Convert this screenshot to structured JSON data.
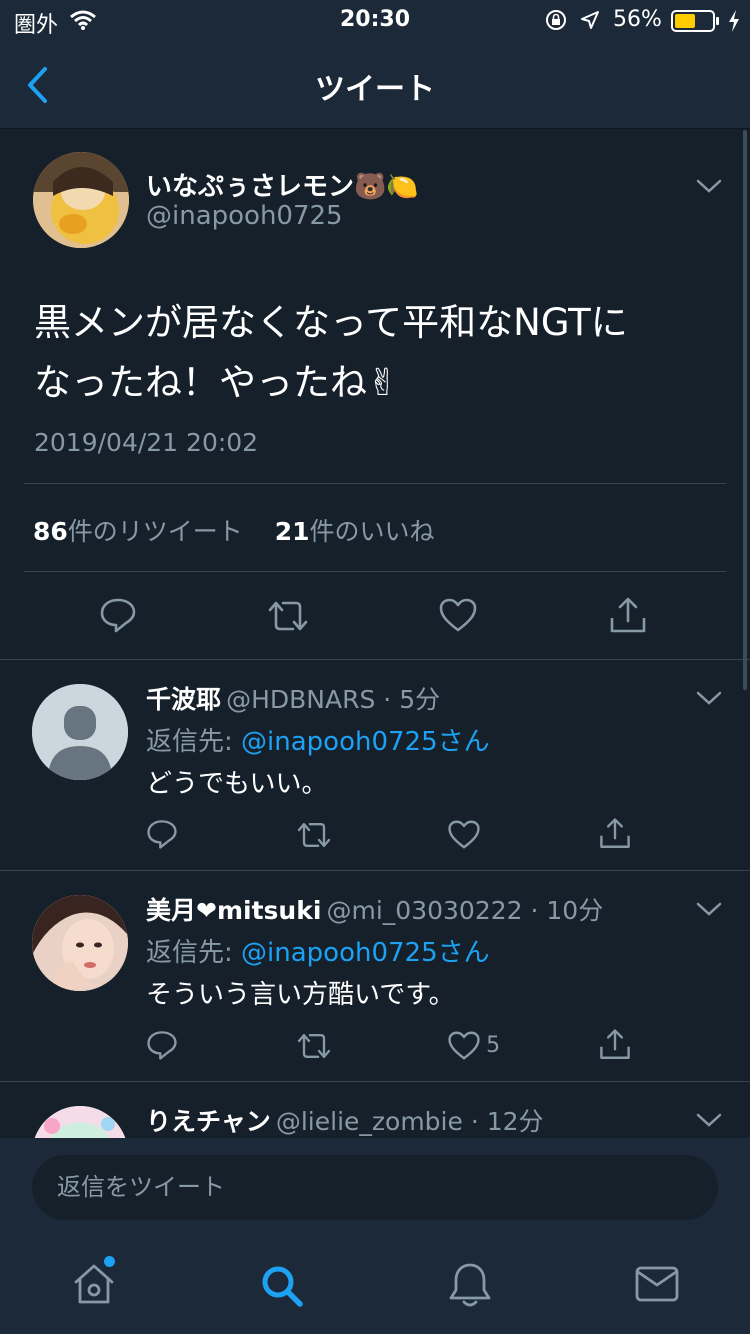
{
  "status_bar": {
    "carrier": "圏外",
    "time": "20:30",
    "battery_percent": "56%",
    "battery_level": 0.56,
    "battery_color": "#ffcc00"
  },
  "header": {
    "title": "ツイート",
    "back_icon": "chevron-left-icon"
  },
  "main_tweet": {
    "display_name": "いなぷぅさレモン🐻🍋",
    "handle": "@inapooh0725",
    "text_line1": "黒メンが居なくなって平和なNGTに",
    "text_line2": "なったね！やったね✌",
    "timestamp": "2019/04/21 20:02",
    "retweet_count": "86",
    "retweet_label": "件のリツイート",
    "like_count": "21",
    "like_label": "件のいいね"
  },
  "replies": [
    {
      "display_name": "千波耶",
      "handle_time": "@HDBNARS · 5分",
      "reply_to_prefix": "返信先: ",
      "reply_to": "@inapooh0725さん",
      "text": "どうでもいい。",
      "like_count": ""
    },
    {
      "display_name": "美月❤mitsuki",
      "handle_time": "@mi_03030222 · 10分",
      "reply_to_prefix": "返信先: ",
      "reply_to": "@inapooh0725さん",
      "text": "そういう言い方酷いです。",
      "like_count": "5"
    },
    {
      "display_name": "りえチャン",
      "handle_time": "@lielie_zombie · 12分"
    }
  ],
  "reply_bar": {
    "placeholder": "返信をツイート"
  },
  "tab_bar": {
    "items": [
      "home-icon",
      "search-icon",
      "notifications-icon",
      "messages-icon"
    ],
    "active": "search-icon",
    "home_has_badge": true
  },
  "colors": {
    "background": "#15202b",
    "surface": "#1c2938",
    "accent": "#1da1f2",
    "muted": "#8899a6",
    "divider": "#38444d"
  }
}
